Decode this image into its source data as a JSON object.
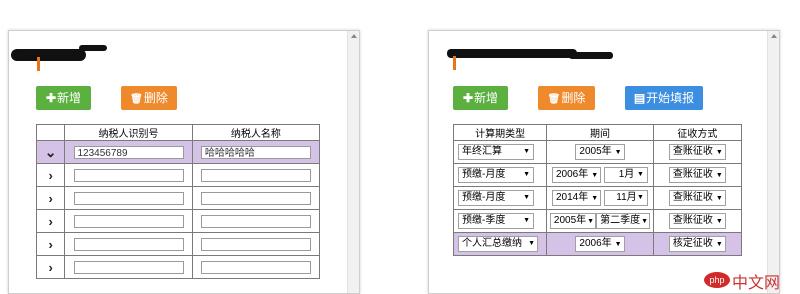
{
  "left_panel": {
    "buttons": {
      "add": {
        "icon": "plus-icon",
        "icon_glyph": "✚",
        "label": "新增"
      },
      "delete": {
        "icon": "trash-icon",
        "icon_glyph": "🗑",
        "label": "删除"
      }
    },
    "table": {
      "headers": [
        "纳税人识别号",
        "纳税人名称"
      ],
      "rows": [
        {
          "expanded": true,
          "arrow": "⌄",
          "id_value": "123456789",
          "name_value": "哈哈哈哈哈"
        },
        {
          "expanded": false,
          "arrow": "›",
          "id_value": "",
          "name_value": ""
        },
        {
          "expanded": false,
          "arrow": "›",
          "id_value": "",
          "name_value": ""
        },
        {
          "expanded": false,
          "arrow": "›",
          "id_value": "",
          "name_value": ""
        },
        {
          "expanded": false,
          "arrow": "›",
          "id_value": "",
          "name_value": ""
        },
        {
          "expanded": false,
          "arrow": "›",
          "id_value": "",
          "name_value": ""
        }
      ]
    }
  },
  "right_panel": {
    "buttons": {
      "add": {
        "icon": "plus-icon",
        "icon_glyph": "✚",
        "label": "新增"
      },
      "delete": {
        "icon": "trash-icon",
        "icon_glyph": "🗑",
        "label": "删除"
      },
      "start": {
        "icon": "form-icon",
        "icon_glyph": "▤",
        "label": "开始填报"
      }
    },
    "table": {
      "headers": [
        "计算期类型",
        "期间",
        "征收方式"
      ],
      "rows": [
        {
          "type": "年终汇算",
          "period": [
            "2005年"
          ],
          "method": "查账征收",
          "highlight": false
        },
        {
          "type": "预缴-月度",
          "period": [
            "2006年",
            "1月"
          ],
          "method": "查账征收",
          "highlight": false
        },
        {
          "type": "预缴-月度",
          "period": [
            "2014年",
            "11月"
          ],
          "method": "查账征收",
          "highlight": false
        },
        {
          "type": "预缴-季度",
          "period": [
            "2005年",
            "第二季度"
          ],
          "method": "查账征收",
          "highlight": false
        },
        {
          "type": "个人汇总缴纳",
          "period": [
            "2006年"
          ],
          "method": "核定征收",
          "highlight": true
        }
      ]
    }
  },
  "watermark": {
    "logo": "php",
    "text": "中文网"
  },
  "colors": {
    "green": "#5cb040",
    "orange": "#ee8a2c",
    "blue": "#3c8ee0",
    "highlight_row": "#d4c3e6"
  }
}
